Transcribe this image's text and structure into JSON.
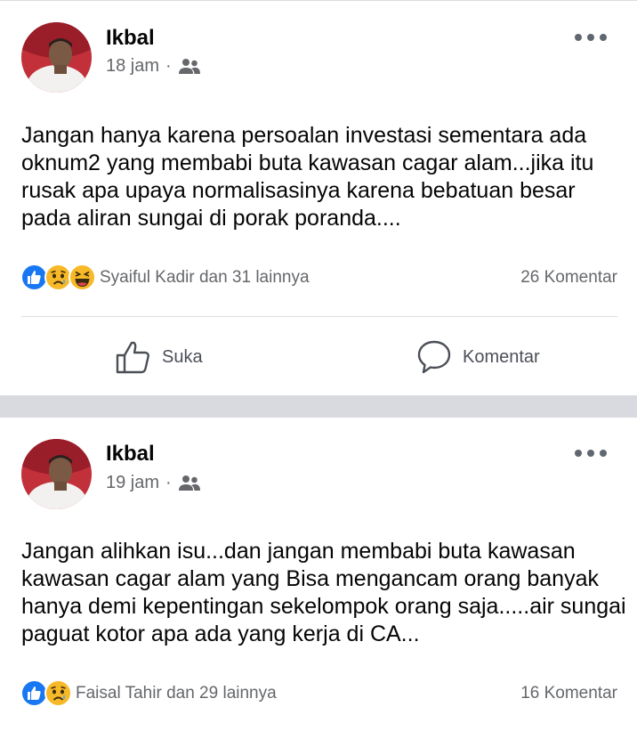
{
  "posts": [
    {
      "author": "Ikbal",
      "time": "18 jam",
      "separator": "·",
      "audience_icon": "friends-icon",
      "text": "Jangan hanya karena persoalan investasi sementara ada oknum2 yang membabi buta kawasan cagar alam...jika itu rusak apa upaya normalisasinya karena bebatuan besar pada aliran sungai di porak poranda....",
      "reactions": [
        "like",
        "sad",
        "haha"
      ],
      "reactors": "Syaiful Kadir dan 31 lainnya",
      "comments": "26 Komentar",
      "like_label": "Suka",
      "comment_label": "Komentar"
    },
    {
      "author": "Ikbal",
      "time": "19 jam",
      "separator": "·",
      "audience_icon": "friends-icon",
      "text": "Jangan alihkan isu...dan jangan membabi buta kawasan kawasan cagar alam yang Bisa mengancam orang banyak hanya demi kepentingan sekelompok orang saja.....air sungai paguat kotor apa ada yang kerja di CA...",
      "reactions": [
        "like",
        "sad"
      ],
      "reactors": "Faisal Tahir dan 29 lainnya",
      "comments": "16 Komentar"
    }
  ],
  "colors": {
    "like_blue": "#1877f2",
    "emoji_yellow": "#f7b928",
    "secondary_text": "#65676b",
    "separator_gray": "#d8dadf"
  }
}
